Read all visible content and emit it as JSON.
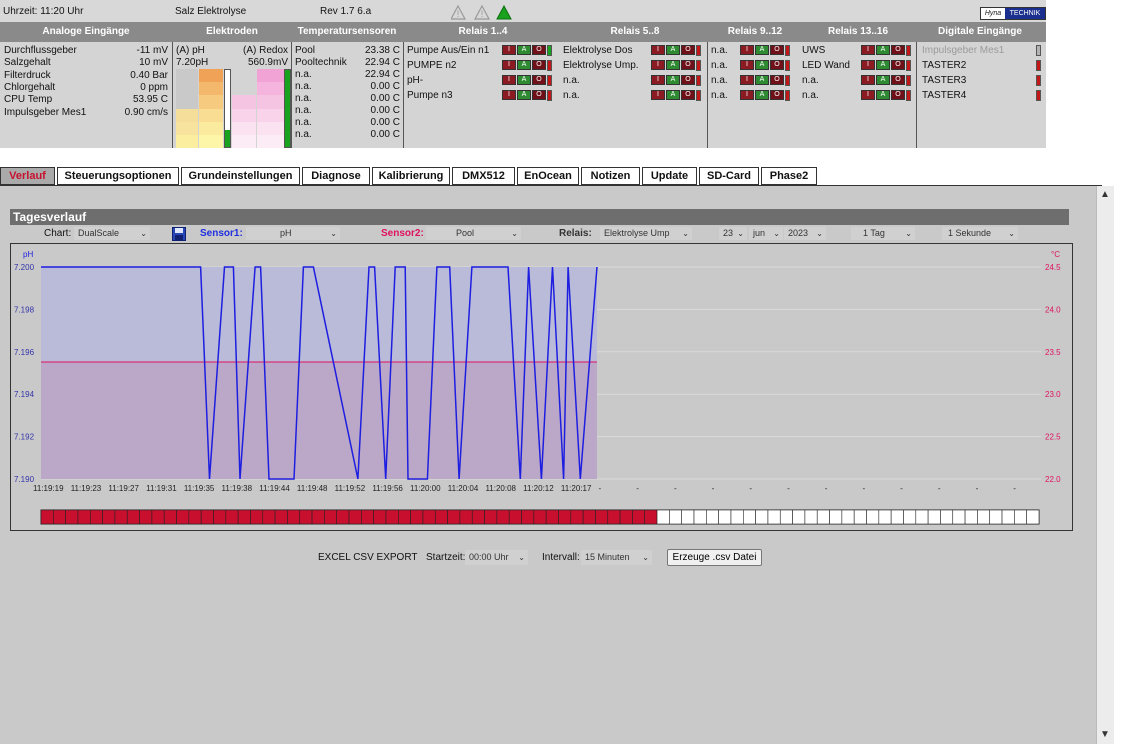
{
  "topbar": {
    "time": "Uhrzeit: 11:20 Uhr",
    "device": "Salz Elektrolyse",
    "revision": "Rev 1.7 6.a",
    "brand_left": "Hyna",
    "brand_right": "TECHNIK"
  },
  "headers": [
    "Analoge Eingänge",
    "Elektroden",
    "Temperatursensoren",
    "Relais 1..4",
    "Relais 5..8",
    "Relais 9..12",
    "Relais 13..16",
    "Digitale Eingänge"
  ],
  "analog": [
    {
      "label": "Durchflussgeber",
      "value": "-11 mV"
    },
    {
      "label": "Salzgehalt",
      "value": "10 mV"
    },
    {
      "label": "Filterdruck",
      "value": "0.40 Bar"
    },
    {
      "label": "Chlorgehalt",
      "value": "0 ppm"
    },
    {
      "label": "CPU Temp",
      "value": "53.95 C"
    },
    {
      "label": "Impulsgeber Mes1",
      "value": "0.90 cm/s"
    }
  ],
  "electrodes": {
    "ph_label": "(A) pH",
    "ph_value": "7.20pH",
    "redox_label": "(A) Redox",
    "redox_value": "560.9mV",
    "ph_colors": [
      "#f0a257",
      "#f3b86c",
      "#f6cb80",
      "#f9dd93",
      "#fbeb9e",
      "#fdf6a8"
    ],
    "redox_colors": [
      "#f2a3d6",
      "#f4b4dd",
      "#f6c4e3",
      "#f8d3ea",
      "#fae2f1",
      "#fcecf5"
    ]
  },
  "temperatures": [
    {
      "label": "Pool",
      "value": "23.38 C"
    },
    {
      "label": "Pooltechnik",
      "value": "22.94 C"
    },
    {
      "label": "n.a.",
      "value": "22.94 C"
    },
    {
      "label": "n.a.",
      "value": "0.00 C"
    },
    {
      "label": "n.a.",
      "value": "0.00 C"
    },
    {
      "label": "n.a.",
      "value": "0.00 C"
    },
    {
      "label": "n.a.",
      "value": "0.00 C"
    },
    {
      "label": "n.a.",
      "value": "0.00 C"
    }
  ],
  "relais_1_4": [
    "Pumpe Aus/Ein n1",
    "PUMPE n2",
    "pH-",
    "Pumpe n3"
  ],
  "relais_5_8": [
    "Elektrolyse Dos",
    "Elektrolyse Ump.",
    "n.a.",
    "n.a."
  ],
  "relais_9_12": [
    "n.a.",
    "n.a.",
    "n.a.",
    "n.a."
  ],
  "relais_13_16": [
    "UWS",
    "LED Wand",
    "n.a.",
    "n.a."
  ],
  "digital_inputs": [
    "Impulsgeber Mes1",
    "TASTER2",
    "TASTER3",
    "TASTER4"
  ],
  "relay_button_labels": {
    "off": "I",
    "auto": "A",
    "on": "O"
  },
  "tabs": [
    "Verlauf",
    "Steuerungsoptionen",
    "Grundeinstellungen",
    "Diagnose",
    "Kalibrierung",
    "DMX512",
    "EnOcean",
    "Notizen",
    "Update",
    "SD-Card",
    "Phase2"
  ],
  "section_title": "Tagesverlauf",
  "controls": {
    "chart_label": "Chart:",
    "chart_value": "DualScale",
    "sensor1_label": "Sensor1:",
    "sensor1_value": "pH",
    "sensor2_label": "Sensor2:",
    "sensor2_value": "Pool",
    "relais_label": "Relais:",
    "relais_value": "Elektrolyse Ump",
    "day": "23",
    "month": "jun",
    "year": "2023",
    "range": "1 Tag",
    "resolution": "1 Sekunde"
  },
  "export": {
    "label": "EXCEL CSV EXPORT",
    "start_label": "Startzeit:",
    "start_value": "00:00 Uhr",
    "interval_label": "Intervall:",
    "interval_value": "15 Minuten",
    "button": "Erzeuge .csv Datei"
  },
  "chart_data": {
    "type": "line",
    "y_left_label": "pH",
    "y_right_label": "°C",
    "y_left_ticks": [
      "7.200",
      "7.198",
      "7.196",
      "7.194",
      "7.192",
      "7.190"
    ],
    "y_right_ticks": [
      "24.5",
      "24.0",
      "23.5",
      "23.0",
      "22.5",
      "22.0"
    ],
    "ylim_left": [
      7.19,
      7.2
    ],
    "ylim_right": [
      22.0,
      24.5
    ],
    "x_ticks": [
      "11:19:19",
      "11:19:23",
      "11:19:27",
      "11:19:31",
      "11:19:35",
      "11:19:38",
      "11:19:44",
      "11:19:48",
      "11:19:52",
      "11:19:56",
      "11:20:00",
      "11:20:04",
      "11:20:08",
      "11:20:12",
      "11:20:17",
      "",
      "",
      "",
      "",
      "",
      "",
      "",
      "",
      "",
      "",
      "",
      ""
    ],
    "series": [
      {
        "axis": "left",
        "color": "#1e1ee0",
        "x": [
          0,
          0.287,
          0.303,
          0.33,
          0.346,
          0.358,
          0.385,
          0.395,
          0.41,
          0.425,
          0.435,
          0.455,
          0.472,
          0.49,
          0.57,
          0.59,
          0.6,
          0.62,
          0.637,
          0.655,
          0.66,
          0.695,
          0.712,
          0.735,
          0.752,
          0.775,
          0.792,
          0.805,
          0.82,
          0.84,
          0.862,
          0.877,
          0.9,
          0.92,
          0.94,
          0.948,
          0.97,
          1.0
        ],
        "y": [
          7.2,
          7.2,
          7.19,
          7.2,
          7.2,
          7.19,
          7.2,
          7.2,
          7.19,
          7.19,
          7.19,
          7.19,
          7.2,
          7.2,
          7.19,
          7.2,
          7.2,
          7.19,
          7.2,
          7.2,
          7.19,
          7.19,
          7.2,
          7.2,
          7.19,
          7.2,
          7.2,
          7.2,
          7.2,
          7.2,
          7.19,
          7.2,
          7.19,
          7.2,
          7.19,
          7.2,
          7.19,
          7.2
        ]
      },
      {
        "axis": "right",
        "color": "#e0115f",
        "x": [
          0,
          1
        ],
        "y": [
          23.38,
          23.38
        ]
      }
    ],
    "x_fraction_of_width": 0.556,
    "relay_bar": {
      "on_segments": 50,
      "off_segments": 31
    }
  }
}
